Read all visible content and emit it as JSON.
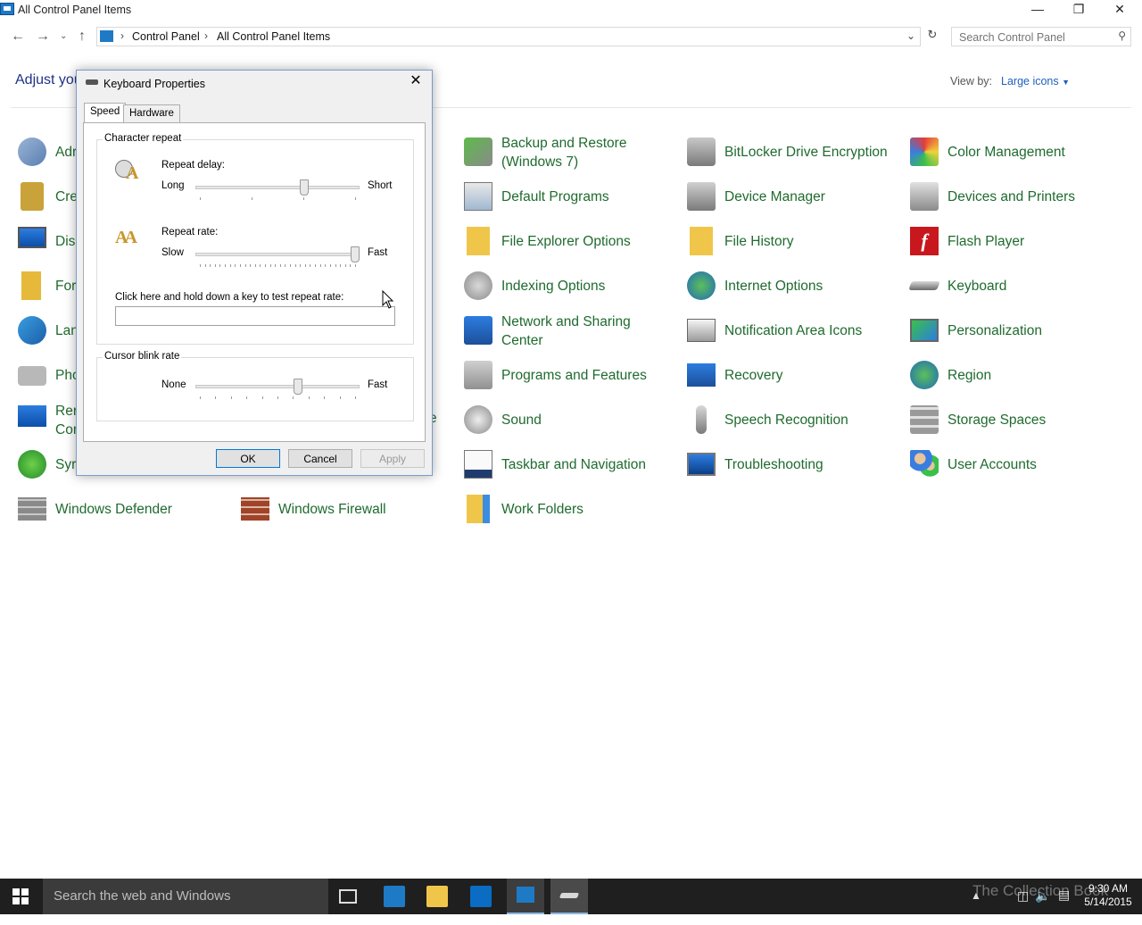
{
  "window": {
    "title": "All Control Panel Items"
  },
  "address": {
    "crumbs": [
      "Control Panel",
      "All Control Panel Items"
    ],
    "search_placeholder": "Search Control Panel"
  },
  "header": {
    "title_visible": "Adjust you",
    "view_by_label": "View by:",
    "view_by_value": "Large icons"
  },
  "items": [
    {
      "label": "Adr",
      "icon": "administrative-tools-icon"
    },
    {
      "label": "Cre",
      "icon": "credential-manager-icon"
    },
    {
      "label": "Dis",
      "icon": "display-icon"
    },
    {
      "label": "For",
      "icon": "fonts-icon"
    },
    {
      "label": "Lan",
      "icon": "language-icon"
    },
    {
      "label": "Pho",
      "icon": "phone-and-modem-icon"
    },
    {
      "label": "Rer",
      "label2": "Cor",
      "icon": "remoteapp-icon"
    },
    {
      "label": "Syr",
      "icon": "sync-center-icon"
    },
    {
      "label": "Windows Defender",
      "icon": "windows-defender-icon"
    },
    {
      "label": "Windows Firewall",
      "icon": "windows-firewall-icon"
    },
    {
      "label": "Backup and Restore",
      "label2": "(Windows 7)",
      "icon": "backup-restore-icon"
    },
    {
      "label": "Default Programs",
      "icon": "default-programs-icon"
    },
    {
      "label": "File Explorer Options",
      "icon": "file-explorer-options-icon"
    },
    {
      "label": "Indexing Options",
      "icon": "indexing-options-icon"
    },
    {
      "label": "Network and Sharing",
      "label2": "Center",
      "icon": "network-sharing-icon"
    },
    {
      "label": "Programs and Features",
      "icon": "programs-features-icon"
    },
    {
      "label": "Sound",
      "icon": "sound-icon"
    },
    {
      "label": "Taskbar and Navigation",
      "icon": "taskbar-navigation-icon"
    },
    {
      "label": "Work Folders",
      "icon": "work-folders-icon"
    },
    {
      "label": "BitLocker Drive Encryption",
      "icon": "bitlocker-icon"
    },
    {
      "label": "Device Manager",
      "icon": "device-manager-icon"
    },
    {
      "label": "File History",
      "icon": "file-history-icon"
    },
    {
      "label": "Internet Options",
      "icon": "internet-options-icon"
    },
    {
      "label": "Notification Area Icons",
      "icon": "notification-area-icon"
    },
    {
      "label": "Recovery",
      "icon": "recovery-icon"
    },
    {
      "label": "Speech Recognition",
      "icon": "speech-recognition-icon"
    },
    {
      "label": "Troubleshooting",
      "icon": "troubleshooting-icon"
    },
    {
      "label": "Color Management",
      "icon": "color-management-icon"
    },
    {
      "label": "Devices and Printers",
      "icon": "devices-printers-icon"
    },
    {
      "label": "Flash Player",
      "icon": "flash-player-icon"
    },
    {
      "label": "Keyboard",
      "icon": "keyboard-icon"
    },
    {
      "label": "Personalization",
      "icon": "personalization-icon"
    },
    {
      "label": "Region",
      "icon": "region-icon"
    },
    {
      "label": "Storage Spaces",
      "icon": "storage-spaces-icon"
    },
    {
      "label": "User Accounts",
      "icon": "user-accounts-icon"
    }
  ],
  "dialog": {
    "title": "Keyboard Properties",
    "tabs": [
      "Speed",
      "Hardware"
    ],
    "character_repeat": {
      "group_label": "Character repeat",
      "repeat_delay_label": "Repeat delay:",
      "delay_left": "Long",
      "delay_right": "Short",
      "delay_value": 0.67,
      "repeat_rate_label": "Repeat rate:",
      "rate_left": "Slow",
      "rate_right": "Fast",
      "rate_value": 1.0,
      "test_label": "Click here and hold down a key to test repeat rate:"
    },
    "cursor_blink": {
      "group_label": "Cursor blink rate",
      "left": "None",
      "right": "Fast",
      "value": 0.63
    },
    "buttons": {
      "ok": "OK",
      "cancel": "Cancel",
      "apply": "Apply"
    }
  },
  "taskbar": {
    "search_placeholder": "Search the web and Windows",
    "time": "9:30 AM",
    "date": "5/14/2015",
    "watermark": "The Collection Book"
  },
  "colors": {
    "link_green": "#1f6b2e",
    "heading_blue": "#1e3287",
    "taskbar": "#1f1f1f"
  }
}
